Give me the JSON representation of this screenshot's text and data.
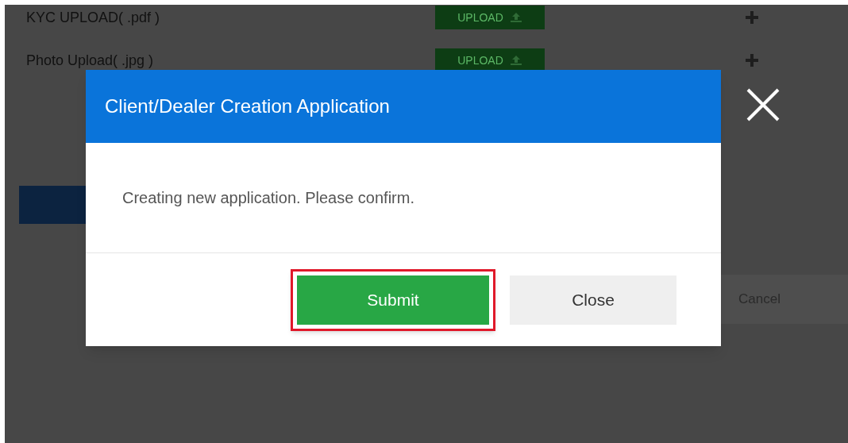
{
  "background_form": {
    "uploads": [
      {
        "label": "KYC UPLOAD( .pdf )",
        "button": "UPLOAD"
      },
      {
        "label": "Photo Upload( .jpg )",
        "button": "UPLOAD"
      }
    ],
    "cancel_button": "Cancel"
  },
  "modal": {
    "title": "Client/Dealer Creation Application",
    "message": "Creating new application. Please confirm.",
    "buttons": [
      {
        "label": "Submit",
        "kind": "primary",
        "highlighted": true
      },
      {
        "label": "Close",
        "kind": "secondary",
        "highlighted": false
      }
    ]
  }
}
